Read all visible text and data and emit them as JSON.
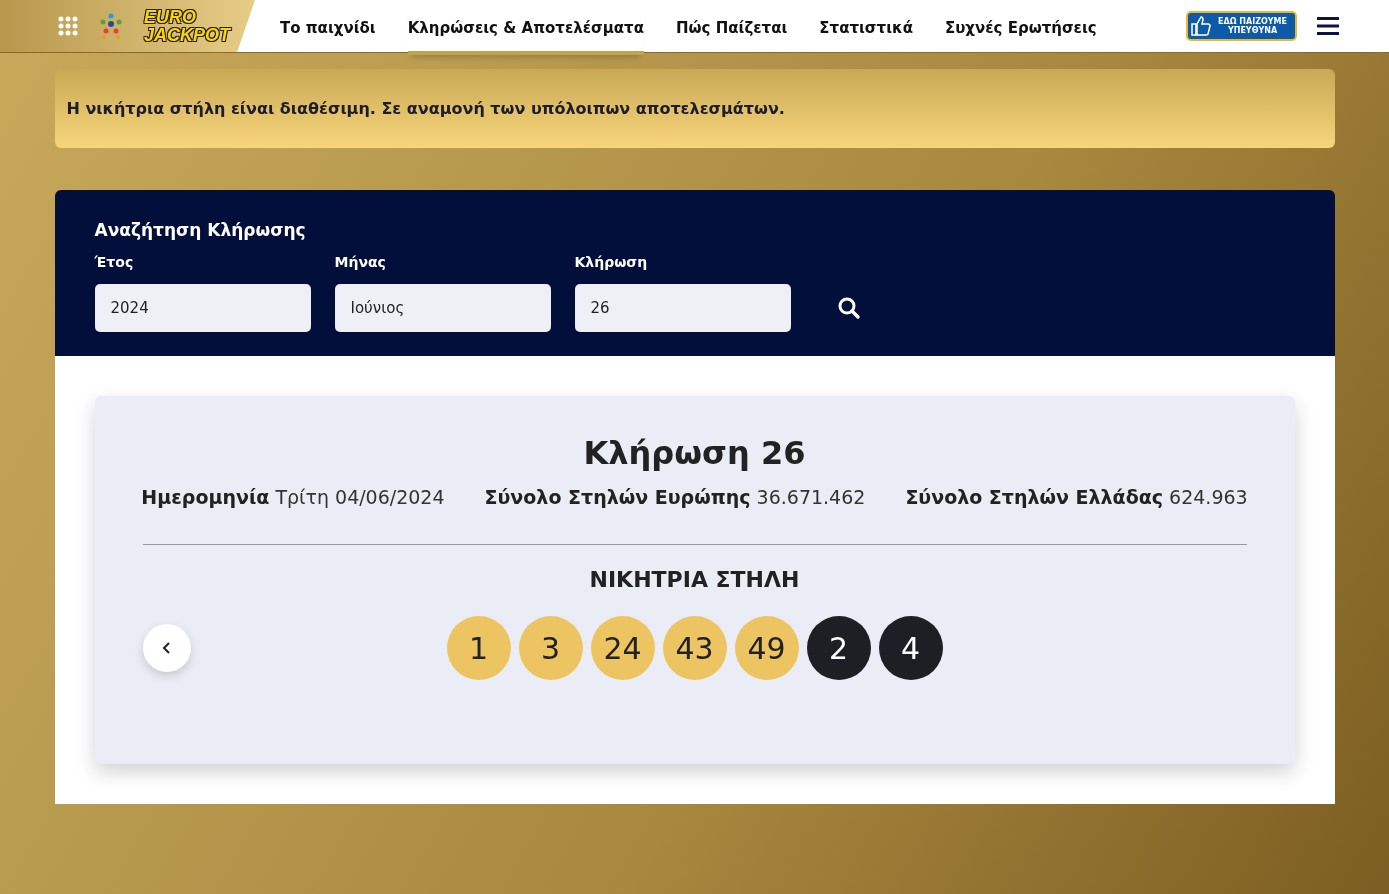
{
  "header": {
    "logo": [
      "EURO",
      "JACKPOT"
    ],
    "nav": [
      {
        "label": "Το παιχνίδι",
        "selected": false
      },
      {
        "label": "Κληρώσεις & Αποτελέσματα",
        "selected": true
      },
      {
        "label": "Πώς Παίζεται",
        "selected": false
      },
      {
        "label": "Στατιστικά",
        "selected": false
      },
      {
        "label": "Συχνές Ερωτήσεις",
        "selected": false
      }
    ],
    "badge": [
      "ΕΔΩ ΠΑΙΖΟΥΜΕ",
      "ΥΠΕΥΘΥΝΑ"
    ]
  },
  "notice": "Η νικήτρια στήλη είναι διαθέσιμη. Σε αναμονή των υπόλοιπων αποτελεσμάτων.",
  "search": {
    "title": "Αναζήτηση Κλήρωσης",
    "fields": [
      {
        "label": "Έτος",
        "value": "2024"
      },
      {
        "label": "Μήνας",
        "value": "Ιούνιος"
      },
      {
        "label": "Κλήρωση",
        "value": "26"
      }
    ]
  },
  "draw": {
    "title": "Κλήρωση 26",
    "facts": [
      {
        "label": "Ημερομηνία",
        "value": "Τρίτη 04/06/2024"
      },
      {
        "label": "Σύνολο Στηλών Ευρώπης",
        "value": "36.671.462"
      },
      {
        "label": "Σύνολο Στηλών Ελλάδας",
        "value": "624.963"
      }
    ],
    "column_title": "ΝΙΚΗΤΡΙΑ ΣΤΗΛΗ",
    "balls": [
      {
        "number": "1",
        "kind": "main"
      },
      {
        "number": "3",
        "kind": "main"
      },
      {
        "number": "24",
        "kind": "main"
      },
      {
        "number": "43",
        "kind": "main"
      },
      {
        "number": "49",
        "kind": "main"
      },
      {
        "number": "2",
        "kind": "euro"
      },
      {
        "number": "4",
        "kind": "euro"
      }
    ]
  }
}
